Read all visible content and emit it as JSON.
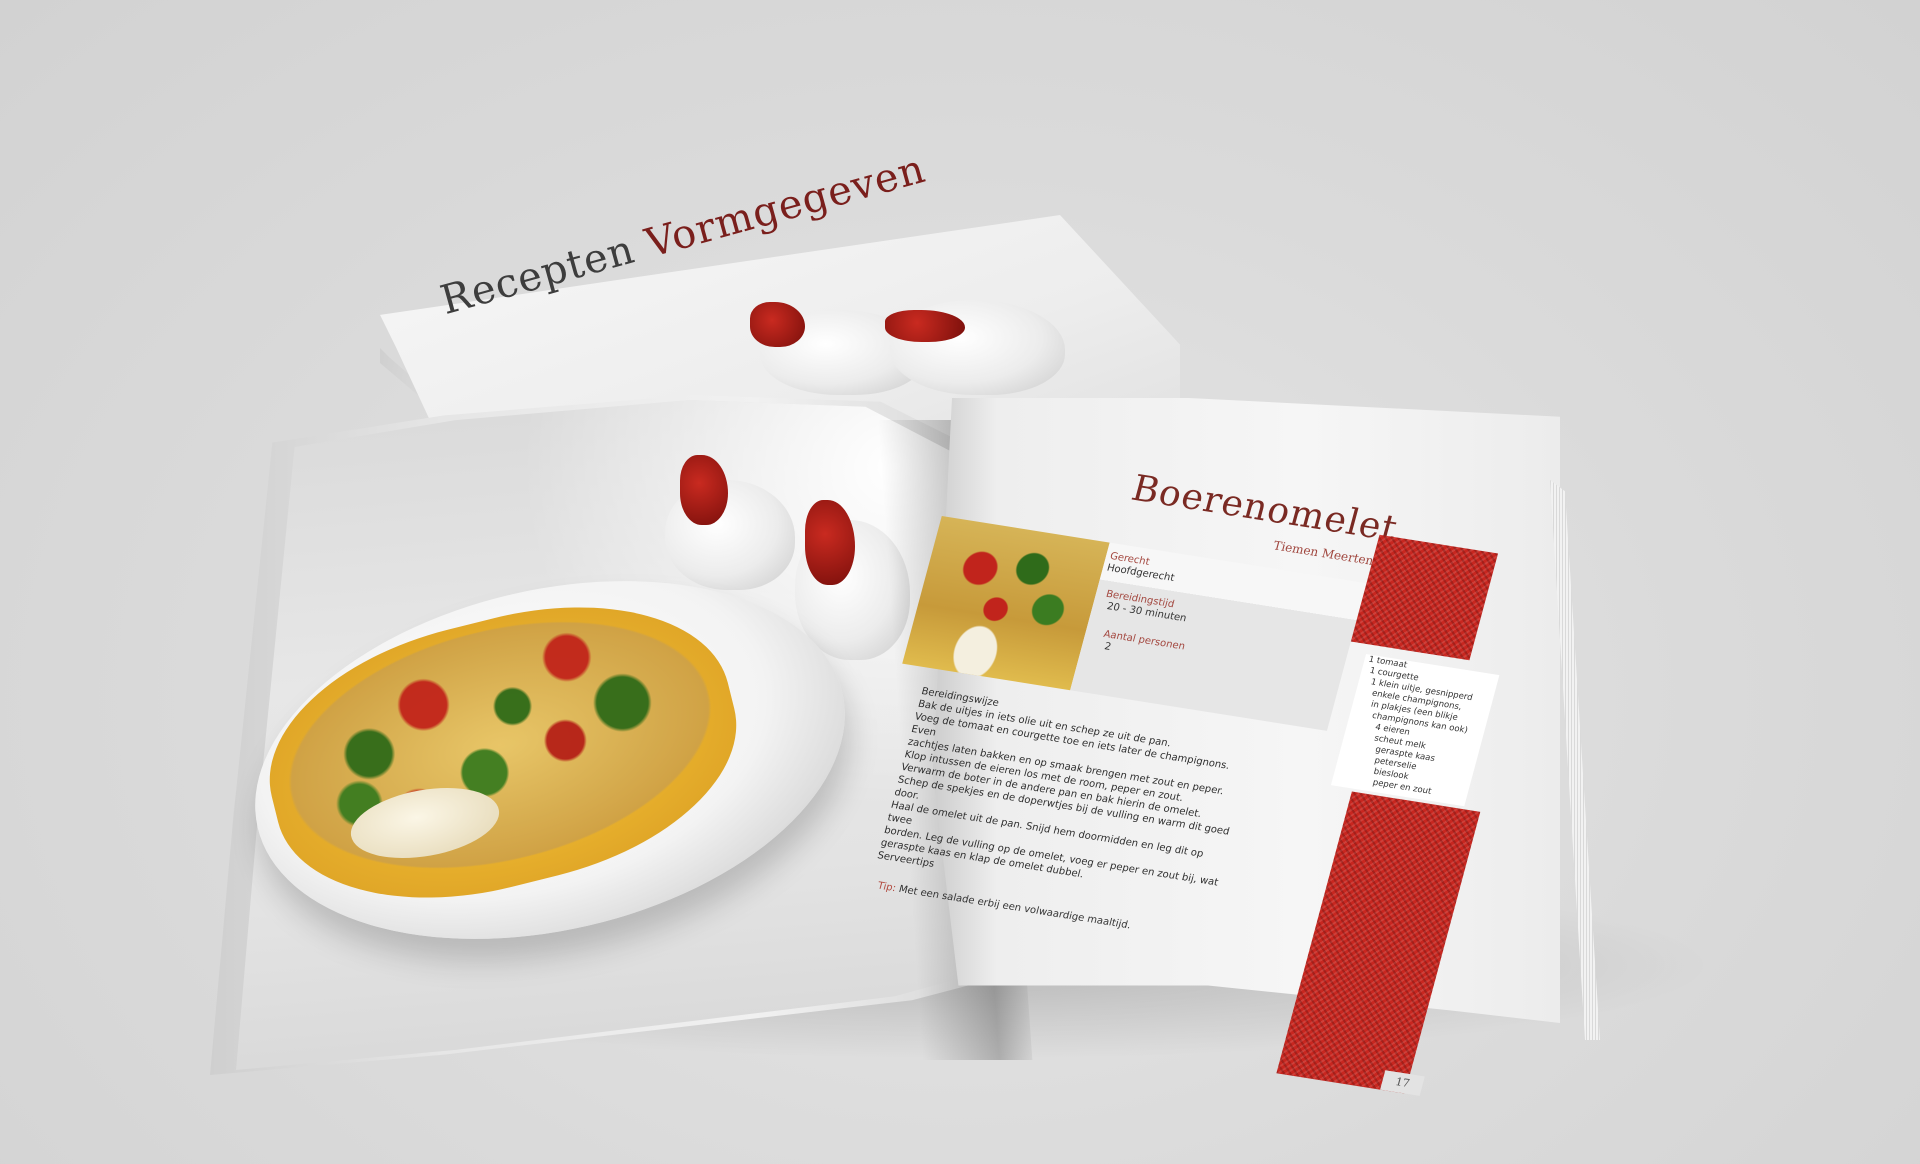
{
  "cover": {
    "title_word1": "Recepten",
    "title_word2": "Vormgegeven"
  },
  "recipe": {
    "title": "Boerenomelet",
    "author": "Tiemen Meertens",
    "gerecht_label": "Gerecht",
    "gerecht_value": "Hoofdgerecht",
    "bereidingstijd_label": "Bereidingstijd",
    "bereidingstijd_value": "20 - 30 minuten",
    "personen_label": "Aantal personen",
    "personen_value": "2",
    "method_heading": "Bereidingswijze",
    "method_lines": [
      "Bak de uitjes in iets olie uit en schep ze uit de pan.",
      "Voeg de tomaat en courgette toe en iets later de champignons. Even",
      "zachtjes laten bakken en op smaak brengen met zout en peper.",
      "Klop intussen de eieren los met de room, peper en zout.",
      "Verwarm de boter in de andere pan en bak hierin de omelet.",
      "Schep de spekjes en de doperwtjes bij de vulling en warm dit goed",
      "door.",
      "Haal de omelet uit de pan. Snijd hem doormidden en leg dit op twee",
      "borden. Leg de vulling op de omelet, voeg er peper en zout bij, wat",
      "geraspte kaas en klap de omelet dubbel.",
      "Serveertips"
    ],
    "tip_label": "Tip:",
    "tip_text": "Met een salade erbij een volwaardige maaltijd.",
    "ingredients": [
      "1 tomaat",
      "1 courgette",
      "1 klein uitje, gesnipperd",
      "enkele champignons,",
      "in plakjes (een blikje",
      "champignons kan ook)",
      "4 eieren",
      "scheut melk",
      "geraspte kaas",
      "peterselie",
      "bieslook",
      "peper en zout"
    ],
    "page_number": "17"
  },
  "colors": {
    "accent_red": "#7a2a23",
    "fabric_red": "#c8261f",
    "background": "#dcdcdc"
  }
}
